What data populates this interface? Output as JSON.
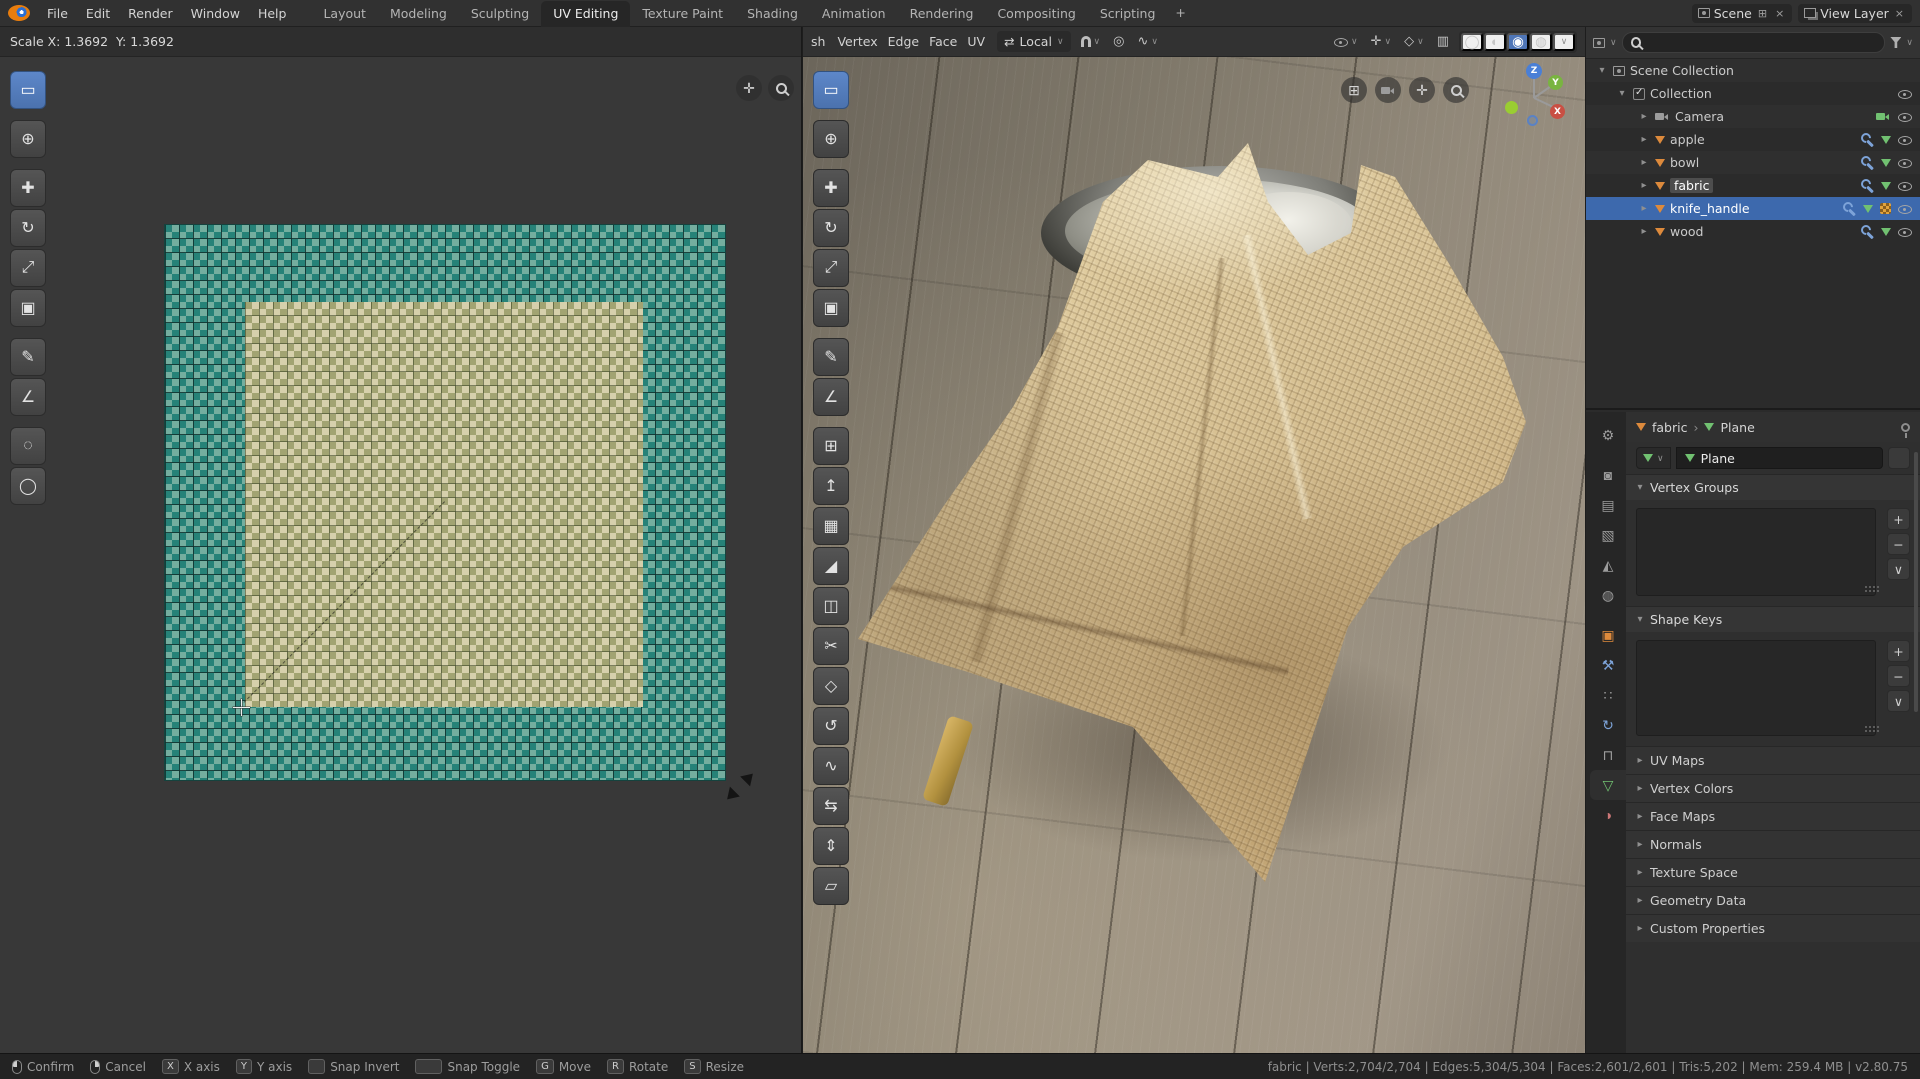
{
  "colors": {
    "accent_blue": "#4772b3",
    "selection_blue": "#3d69ad",
    "object_orange": "#dd8a3c",
    "mesh_green": "#71c171",
    "uv_teal": "#2c8c82"
  },
  "ui": {
    "tri_right": "▸",
    "tri_down": "▾",
    "chevron_down": "∨",
    "breadcrumb_sep": "›",
    "plus": "+",
    "minus": "−",
    "close": "×",
    "copy": "⊞",
    "pan": "✛",
    "orient": "⇄",
    "prop_circle": "◎",
    "falloff": "∿",
    "xray": "▥",
    "overlay": "◇",
    "gizmo_cross": "✛",
    "grid": "⊞",
    "shade_wire": "◯",
    "shade_solid": "◐",
    "shade_mat": "◉",
    "shade_render": "◍"
  },
  "topbar": {
    "menus": [
      {
        "label": "File"
      },
      {
        "label": "Edit"
      },
      {
        "label": "Render"
      },
      {
        "label": "Window"
      },
      {
        "label": "Help"
      }
    ],
    "workspace_tabs": [
      {
        "label": "Layout"
      },
      {
        "label": "Modeling"
      },
      {
        "label": "Sculpting"
      },
      {
        "label": "UV Editing",
        "cls": "active"
      },
      {
        "label": "Texture Paint"
      },
      {
        "label": "Shading"
      },
      {
        "label": "Animation"
      },
      {
        "label": "Rendering"
      },
      {
        "label": "Compositing"
      },
      {
        "label": "Scripting"
      }
    ],
    "add_tab_label": "+",
    "scene_selector": {
      "label": "Scene"
    },
    "view_layer_selector": {
      "label": "View Layer"
    }
  },
  "uv_editor": {
    "modal_status": "Scale X: 1.3692  Y: 1.3692",
    "tools": [
      {
        "name": "select-box",
        "glyph": "▭",
        "cls": "active"
      },
      {
        "name": "cursor",
        "glyph": "⊕",
        "cls": "gap"
      },
      {
        "name": "move",
        "glyph": "✚",
        "cls": "gap"
      },
      {
        "name": "rotate",
        "glyph": "↻"
      },
      {
        "name": "scale",
        "glyph": "⤢"
      },
      {
        "name": "transform",
        "glyph": "▣"
      },
      {
        "name": "annotate",
        "glyph": "✎",
        "cls": "gap"
      },
      {
        "name": "measure",
        "glyph": "∠"
      },
      {
        "name": "grab",
        "glyph": "◌",
        "cls": "gap"
      },
      {
        "name": "relax",
        "glyph": "◯"
      }
    ]
  },
  "viewport": {
    "header": {
      "clipped_menu": "sh",
      "menus": [
        {
          "label": "Vertex"
        },
        {
          "label": "Edge"
        },
        {
          "label": "Face"
        },
        {
          "label": "UV"
        }
      ],
      "orientation_label": "Local"
    },
    "tools": [
      {
        "name": "select-box",
        "glyph": "▭",
        "cls": "active"
      },
      {
        "name": "cursor",
        "glyph": "⊕",
        "cls": "gap"
      },
      {
        "name": "move",
        "glyph": "✚",
        "cls": "gap"
      },
      {
        "name": "rotate",
        "glyph": "↻"
      },
      {
        "name": "scale",
        "glyph": "⤢"
      },
      {
        "name": "transform",
        "glyph": "▣"
      },
      {
        "name": "annotate",
        "glyph": "✎",
        "cls": "gap"
      },
      {
        "name": "measure",
        "glyph": "∠"
      },
      {
        "name": "add-cube",
        "glyph": "⊞",
        "cls": "gap"
      },
      {
        "name": "extrude-region",
        "glyph": "↥"
      },
      {
        "name": "inset-faces",
        "glyph": "▦"
      },
      {
        "name": "bevel",
        "glyph": "◢"
      },
      {
        "name": "loop-cut",
        "glyph": "◫"
      },
      {
        "name": "knife",
        "glyph": "✂"
      },
      {
        "name": "poly-build",
        "glyph": "◇"
      },
      {
        "name": "spin",
        "glyph": "↺"
      },
      {
        "name": "smooth",
        "glyph": "∿"
      },
      {
        "name": "edge-slide",
        "glyph": "⇆"
      },
      {
        "name": "shrink-fatten",
        "glyph": "⇕"
      },
      {
        "name": "shear",
        "glyph": "▱"
      }
    ],
    "gizmo": {
      "x": "X",
      "y": "Y",
      "z": "Z"
    }
  },
  "outliner": {
    "rows": [
      {
        "label": "Scene Collection"
      },
      {
        "label": "Collection"
      },
      {
        "label": "Camera"
      },
      {
        "label": "apple"
      },
      {
        "label": "bowl"
      },
      {
        "label": "fabric"
      },
      {
        "label": "knife_handle"
      },
      {
        "label": "wood"
      }
    ]
  },
  "properties": {
    "tabs": [
      {
        "name": "tool",
        "glyph": "⚙"
      },
      {
        "name": "render",
        "glyph": "◙",
        "cls": "gapA"
      },
      {
        "name": "output",
        "glyph": "▤"
      },
      {
        "name": "view-layer",
        "glyph": "▧"
      },
      {
        "name": "scene",
        "glyph": "◭"
      },
      {
        "name": "world",
        "glyph": "◍"
      },
      {
        "name": "object",
        "glyph": "▣",
        "cls": "orange gapA"
      },
      {
        "name": "modifiers",
        "glyph": "⚒",
        "cls": "blue"
      },
      {
        "name": "particles",
        "glyph": "∷"
      },
      {
        "name": "physics",
        "glyph": "↻",
        "cls": "blue"
      },
      {
        "name": "constraints",
        "glyph": "⊓"
      },
      {
        "name": "object-data",
        "glyph": "▽",
        "cls": "green active"
      },
      {
        "name": "material",
        "glyph": "◑",
        "cls": "red"
      }
    ],
    "breadcrumb": {
      "object": "fabric",
      "data": "Plane"
    },
    "datablock": {
      "name": "Plane"
    },
    "panels_expanded": [
      {
        "label": "Vertex Groups"
      },
      {
        "label": "Shape Keys"
      }
    ],
    "panels_collapsed": [
      {
        "label": "UV Maps"
      },
      {
        "label": "Vertex Colors"
      },
      {
        "label": "Face Maps"
      },
      {
        "label": "Normals"
      },
      {
        "label": "Texture Space"
      },
      {
        "label": "Geometry Data"
      },
      {
        "label": "Custom Properties"
      }
    ]
  },
  "statusbar": {
    "hints": [
      {
        "label": "Confirm"
      },
      {
        "label": "Cancel"
      },
      {
        "key": "X",
        "label": "X axis"
      },
      {
        "key": "Y",
        "label": "Y axis"
      },
      {
        "label": "Snap Invert"
      },
      {
        "label": "Snap Toggle"
      },
      {
        "key": "G",
        "label": "Move"
      },
      {
        "key": "R",
        "label": "Rotate"
      },
      {
        "key": "S",
        "label": "Resize"
      }
    ],
    "stats": "fabric | Verts:2,704/2,704 | Edges:5,304/5,304 | Faces:2,601/2,601 | Tris:5,202 | Mem: 259.4 MB | v2.80.75"
  }
}
